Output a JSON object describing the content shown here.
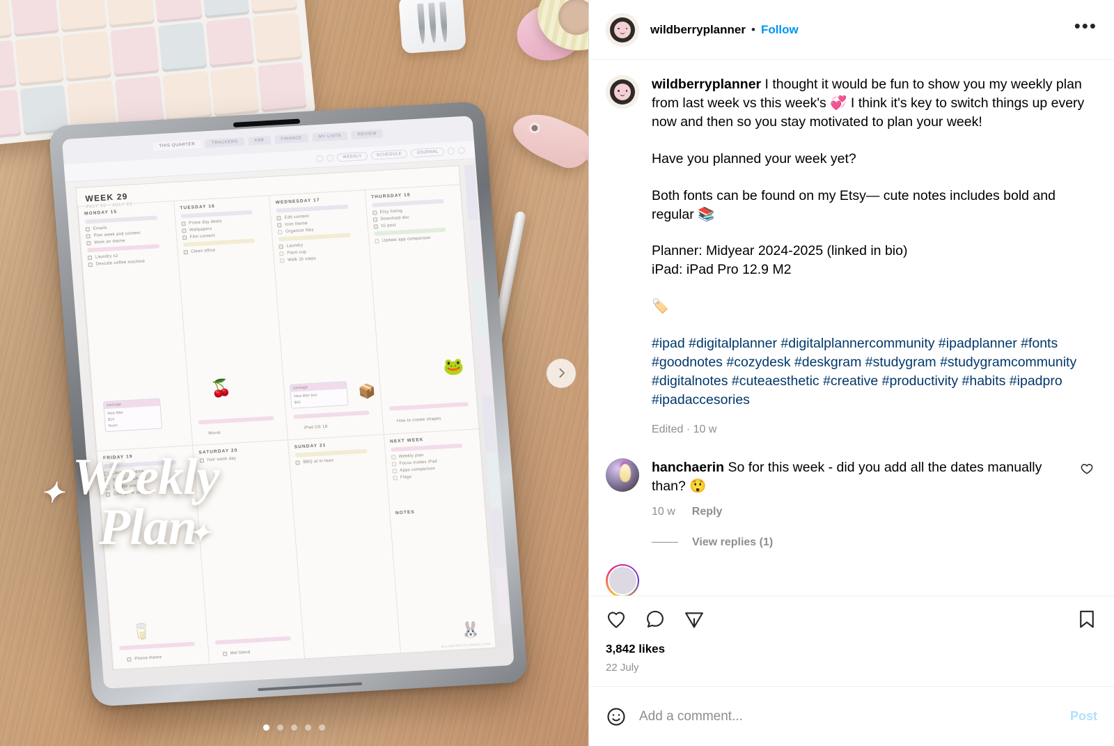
{
  "header": {
    "username": "wildberryplanner",
    "separator": "•",
    "follow_label": "Follow",
    "more_icon": "•••"
  },
  "caption": {
    "username": "wildberryplanner",
    "paragraph_1": " I thought it would be fun to show you my weekly plan from last week vs this week's 💞 I think it's key to switch things up every now and then so you stay motivated to plan your week!",
    "paragraph_2": "Have you planned your week yet?",
    "paragraph_3": "Both fonts can be found on my Etsy— cute notes includes bold and regular 📚",
    "paragraph_4": "Planner: Midyear 2024-2025 (linked in bio)",
    "paragraph_5": "iPad: iPad Pro 12.9 M2",
    "paragraph_6": "🏷️",
    "hashtags": "#ipad #digitalplanner #digitalplannercommunity #ipadplanner #fonts #goodnotes #cozydesk #deskgram #studygram #studygramcommunity #digitalnotes #cuteaesthetic #creative #productivity #habits #ipadpro #ipadaccesories",
    "meta": "Edited · 10 w"
  },
  "comments": [
    {
      "username": "hanchaerin",
      "text": " So for this week - did you add all the dates manually than? 😲",
      "time": "10 w",
      "reply_label": "Reply",
      "view_replies_label": "View replies (1)"
    }
  ],
  "actions": {
    "like_icon": "heart-icon",
    "comment_icon": "comment-icon",
    "share_icon": "share-icon",
    "save_icon": "bookmark-icon",
    "likes_count": "3,842 likes",
    "date": "22 July"
  },
  "compose": {
    "emoji_icon": "emoji-icon",
    "placeholder": "Add a comment...",
    "value": "",
    "post_label": "Post"
  },
  "media": {
    "next_label": "Next",
    "overlay_line1": "Weekly",
    "overlay_line2": "Plan",
    "dots_total": 5,
    "dot_active_index": 0,
    "planner": {
      "week_title": "WEEK 29",
      "week_range": "JULY 15 - JULY 21",
      "app_tabs": [
        "KBB",
        "FINANCE",
        "MY LISTS",
        "REVIEW"
      ],
      "app_tabs2": [
        "THIS QUARTER",
        "TRACKERS"
      ],
      "view_pills": [
        "WEEKLY",
        "SCHEDULE",
        "JOURNAL"
      ],
      "days": [
        {
          "label": "MONDAY 15",
          "tasks": [
            "Emails",
            "Plan week and content",
            "Work on theme",
            "Laundry x2",
            "Descale coffee machine"
          ]
        },
        {
          "label": "TUESDAY 16",
          "tasks": [
            "Prime day deals",
            "Wallpapers",
            "Film content",
            "Clean office"
          ]
        },
        {
          "label": "WEDNESDAY 17",
          "tasks": [
            "Edit content",
            "Icon theme",
            "Organize files",
            "Laundry",
            "Paint cup",
            "Walk 1k steps"
          ]
        },
        {
          "label": "THURSDAY 18",
          "tasks": [
            "Etsy listing",
            "Download doc",
            "IG post",
            "Update app comparison"
          ]
        },
        {
          "label": "FRIDAY 19",
          "tasks": [
            "Launch scheme",
            "Send swatch",
            "Update site",
            "Change to new plan"
          ]
        },
        {
          "label": "SATURDAY 20",
          "tasks": [
            "Hair wash day"
          ]
        },
        {
          "label": "SUNDAY 21",
          "tasks": [
            "BBQ at in-laws"
          ]
        },
        {
          "label": "NEXT WEEK",
          "tasks": [
            "Weekly plan",
            "Focus modes iPad",
            "Apps comparison",
            "Flags"
          ]
        }
      ],
      "notes_label": "NOTES",
      "note_cards": [
        {
          "title": "package",
          "lines": [
            "New litter",
            "$14",
            "Noon"
          ]
        },
        {
          "title": "package",
          "lines": [
            "New litter box",
            "$41"
          ]
        }
      ],
      "mini_labels": [
        "Movie",
        "iPad OS 18",
        "How to create shapes",
        "Phone theme",
        "Mal blend"
      ],
      "footer": "WILDBERRYPLANNER.COM"
    }
  },
  "colors": {
    "link": "#0095f6",
    "hashtag": "#00376b",
    "muted": "#8e8e8e",
    "post_disabled": "#b2dffc",
    "border": "#dbdbdb"
  }
}
